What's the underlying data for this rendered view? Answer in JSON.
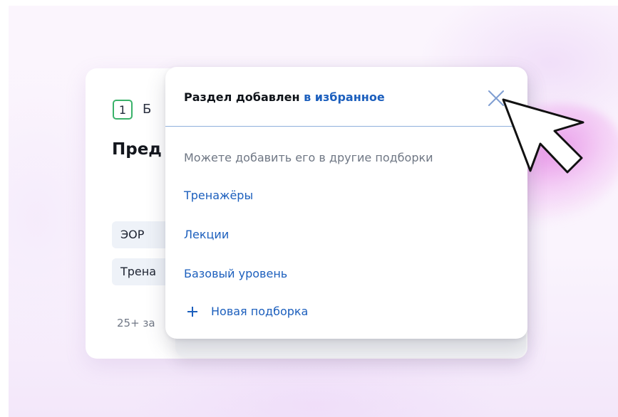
{
  "background_card": {
    "number": "1",
    "label_fragment": "Б",
    "title_fragment": "Пред",
    "chips": [
      "ЭОР",
      "Трена"
    ],
    "footer_fragment": "25+ за"
  },
  "popup": {
    "title_prefix": "Раздел добавлен",
    "title_link": "в избранное",
    "hint": "Можете добавить его в другие подборки",
    "options": [
      "Тренажёры",
      "Лекции",
      "Базовый уровень"
    ],
    "new_collection_label": "Новая подборка"
  },
  "icons": {
    "close": "close-icon",
    "plus": "plus-icon",
    "cursor": "mouse-pointer-icon"
  },
  "colors": {
    "accent": "#1c5fbd",
    "badge_border": "#3ab26a",
    "glow": "#e27ae2"
  }
}
